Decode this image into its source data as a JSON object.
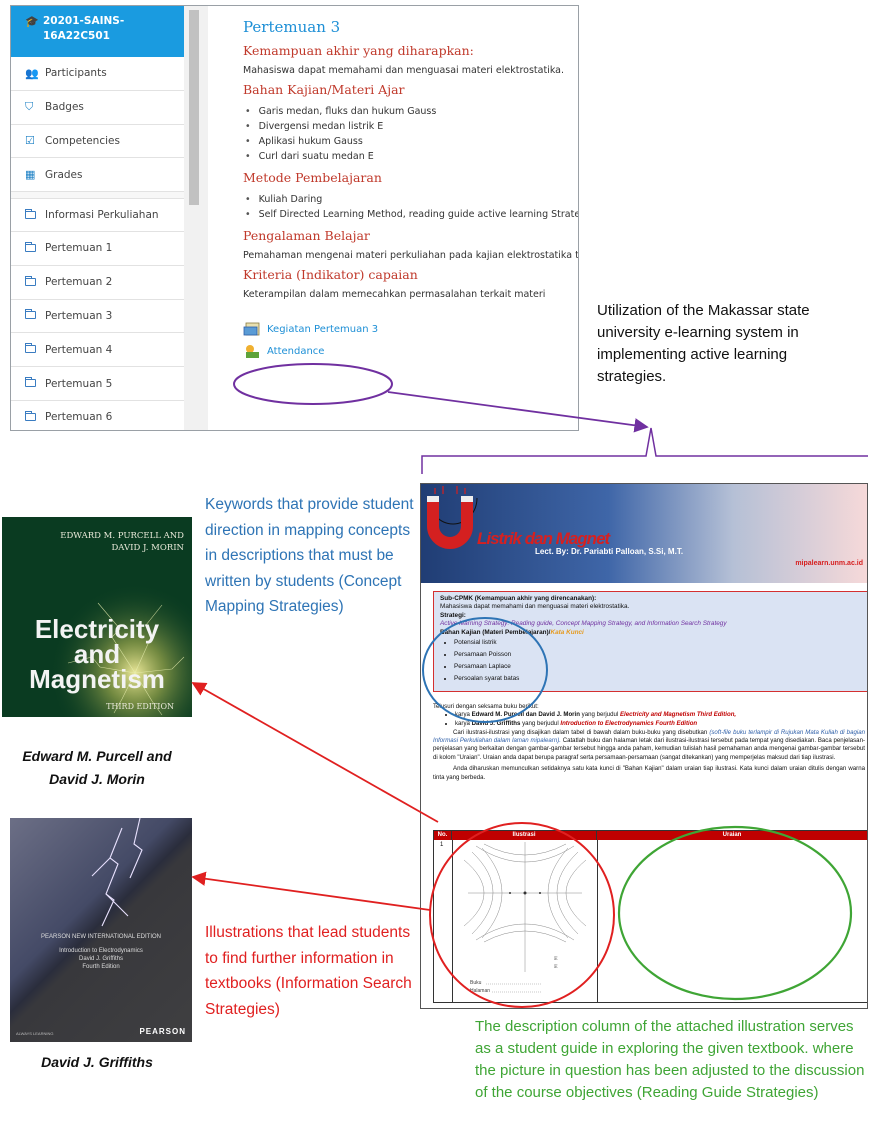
{
  "lms": {
    "course": "20201-SAINS-16A22C501",
    "nav": [
      {
        "label": "Participants",
        "icon": "users-icon"
      },
      {
        "label": "Badges",
        "icon": "badge-icon"
      },
      {
        "label": "Competencies",
        "icon": "checkbox-icon"
      },
      {
        "label": "Grades",
        "icon": "table-icon"
      },
      {
        "label": "Informasi Perkuliahan",
        "icon": "folder-icon"
      },
      {
        "label": "Pertemuan 1",
        "icon": "folder-icon"
      },
      {
        "label": "Pertemuan 2",
        "icon": "folder-icon"
      },
      {
        "label": "Pertemuan 3",
        "icon": "folder-icon"
      },
      {
        "label": "Pertemuan 4",
        "icon": "folder-icon"
      },
      {
        "label": "Pertemuan 5",
        "icon": "folder-icon"
      },
      {
        "label": "Pertemuan 6",
        "icon": "folder-icon"
      }
    ],
    "content": {
      "title": "Pertemuan 3",
      "h_kemampuan": "Kemampuan akhir yang diharapkan:",
      "p_kemampuan": "Mahasiswa dapat memahami dan menguasai materi elektrostatika.",
      "h_bahan": "Bahan Kajian/Materi Ajar",
      "bahan": [
        "Garis medan, fluks dan hukum Gauss",
        "Divergensi medan listrik E",
        "Aplikasi hukum Gauss",
        "Curl dari suatu medan E"
      ],
      "h_metode": "Metode Pembelajaran",
      "metode": [
        "Kuliah Daring",
        "Self Directed Learning Method, reading guide active learning Strategy"
      ],
      "h_pengalaman": "Pengalaman Belajar",
      "p_pengalaman": "Pemahaman mengenai materi perkuliahan pada kajian elektrostatika terkait",
      "h_kriteria": "Kriteria (Indikator) capaian",
      "p_kriteria": "Keterampilan dalam memecahkan permasalahan terkait materi",
      "link_kegiatan": "Kegiatan Pertemuan 3",
      "link_attendance": "Attendance"
    }
  },
  "annotations": {
    "utilization": "Utilization of the Makassar state university e-learning system in implementing active learning strategies.",
    "keywords": "Keywords that provide student direction in mapping concepts in descriptions that must be written by students (Concept Mapping Strategies)",
    "illustrations": "Illustrations that lead students to find further information in textbooks (Information Search Strategies)",
    "description": "The description column of the attached illustration serves as a student guide in exploring the given textbook. where the picture in question has been adjusted to the discussion of the course objectives (Reading Guide Strategies)"
  },
  "book1": {
    "authors_1": "EDWARD M. PURCELL AND",
    "authors_2": "DAVID J. MORIN",
    "title_1": "Electricity",
    "title_2": "and",
    "title_3": "Magnetism",
    "edition": "THIRD EDITION",
    "caption_1": "Edward M. Purcell and",
    "caption_2": "David J. Morin"
  },
  "book2": {
    "series": "PEARSON NEW INTERNATIONAL EDITION",
    "title": "Introduction to Electrodynamics",
    "author": "David J. Griffiths",
    "edition": "Fourth Edition",
    "brand": "ALWAYS LEARNING",
    "publisher": "PEARSON",
    "caption": "David J. Griffiths"
  },
  "doc": {
    "banner_title": "Listrik dan Magnet",
    "banner_lect": "Lect. By: Dr. Pariabti Palloan, S.Si, M.T.",
    "banner_site": "mipalearn.unm.ac.id",
    "sub_cpmk": "Sub-CPMK (Kemampuan akhir yang direncanakan):",
    "sub_cpmk_text": "Mahasiswa dapat memahami dan menguasai materi elektrostatika.",
    "strategi_label": "Strategi:",
    "strategi_text": "Active learning Strategy: Reading guide, Concept Mapping Strategy, and Information Search Strategy",
    "bahan_label": "Bahan Kajian (Materi Pembelajaran)/",
    "kata_kunci": "Kata Kunci",
    "keywords": [
      "Potensial listrik",
      "Persamaan Poisson",
      "Persamaan Laplace",
      "Persoalan syarat batas"
    ],
    "intro": "Telusuri dengan seksama buku berikut:",
    "book_a_pre": "karya",
    "book_a_author": "Edward M. Purcell dan David J. Morin",
    "book_a_mid": "yang berjudul",
    "book_a_title": "Electricity and Magnetism Third Edition,",
    "book_b_pre": "karya",
    "book_b_author": "David J. Griffiths",
    "book_b_mid": "yang berjudul",
    "book_b_title": "Introduction to Electrodynamics Fourth Edition",
    "para1_a": "Cari ilustrasi-ilustrasi yang disajikan dalam tabel di bawah dalam buku-buku yang disebutkan",
    "para1_b": "(soft-file buku terlampir di Rujukan Mata Kuliah di bagian Informasi Perkuliahan dalam laman mipalearn).",
    "para1_c": "Catatlah buku dan halaman letak dari ilustrasi-ilustrasi tersebut pada tempat yang disediakan. Baca penjelasan-penjelasan yang berkaitan dengan gambar-gambar tersebut hingga anda paham, kemudian tulislah hasil pemahaman anda mengenai gambar-gambar tersebut di kolom \"Uraian\". Uraian anda dapat berupa paragraf serta persamaan-persamaan (sangat ditekankan) yang memperjelas maksud dari tiap ilustrasi.",
    "para2": "Anda diharuskan memunculkan setidaknya satu kata kunci di \"Bahan Kajian\" dalam uraian tiap ilustrasi. Kata kunci dalam uraian ditulis dengan warna tinta yang berbeda.",
    "col_no": "No.",
    "col_ilustrasi": "Ilustrasi",
    "col_uraian": "Uraian",
    "row_no": "1",
    "buku_label": "Buku",
    "halaman_label": "Halaman"
  },
  "colors": {
    "moodle_blue": "#1a9be0",
    "purple_arrow": "#7030a0",
    "red_arrow": "#e02020",
    "blue_circle": "#2e74b5",
    "green_circle": "#3fa535"
  }
}
